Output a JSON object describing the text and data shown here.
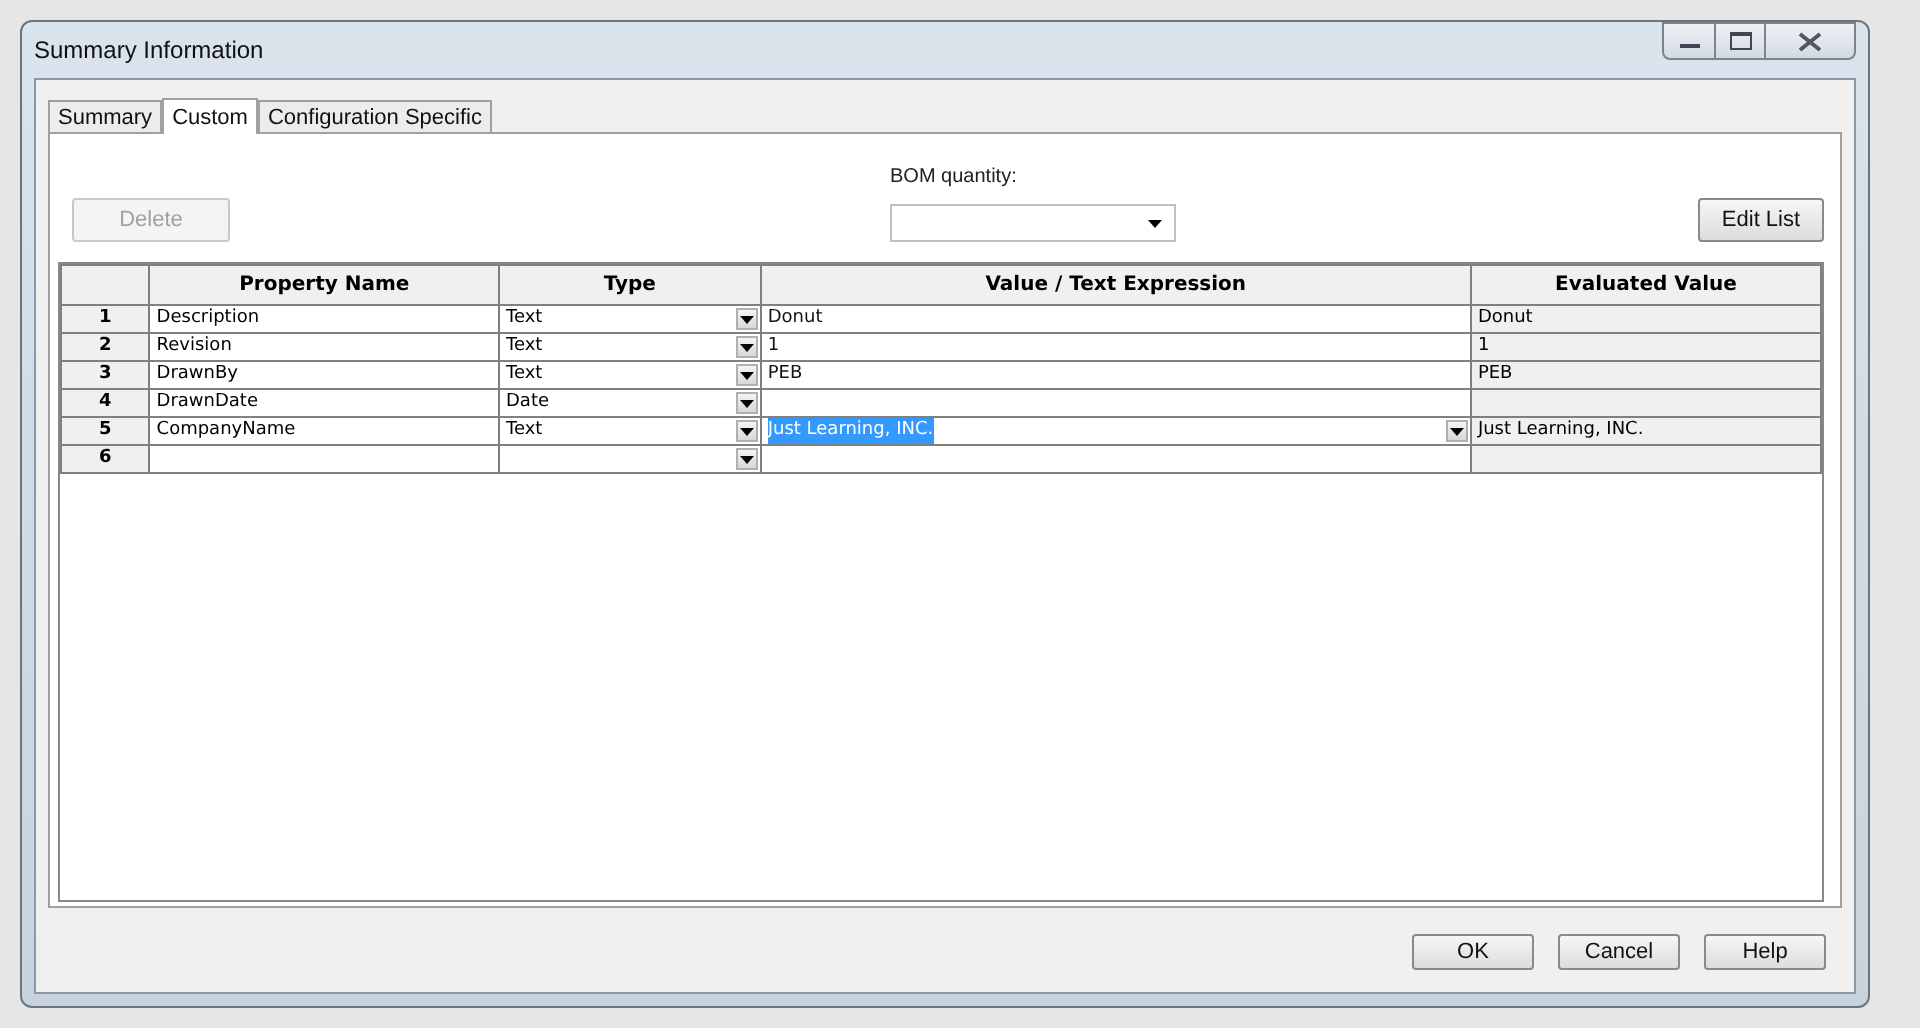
{
  "window": {
    "title": "Summary Information"
  },
  "tabs": [
    {
      "label": "Summary",
      "selected": false
    },
    {
      "label": "Custom",
      "selected": true
    },
    {
      "label": "Configuration Specific",
      "selected": false
    }
  ],
  "delete_button": {
    "label": "Delete",
    "disabled": true
  },
  "bom_quantity": {
    "label": "BOM quantity:"
  },
  "edit_list_button": {
    "label": "Edit List"
  },
  "table": {
    "columns": [
      "Property Name",
      "Type",
      "Value / Text Expression",
      "Evaluated Value"
    ],
    "rows": [
      {
        "number": "1",
        "name": "Description",
        "type": "Text",
        "value": "Donut",
        "evaluated": "Donut",
        "selected": false
      },
      {
        "number": "2",
        "name": "Revision",
        "type": "Text",
        "value": "1",
        "evaluated": "1",
        "selected": false
      },
      {
        "number": "3",
        "name": "DrawnBy",
        "type": "Text",
        "value": "PEB",
        "evaluated": "PEB",
        "selected": false
      },
      {
        "number": "4",
        "name": "DrawnDate",
        "type": "Date",
        "value": "",
        "evaluated": "",
        "selected": false
      },
      {
        "number": "5",
        "name": "CompanyName",
        "type": "Text",
        "value": "Just Learning, INC.",
        "evaluated": "Just Learning, INC.",
        "selected": true
      },
      {
        "number": "6",
        "name": "",
        "type": "",
        "value": "",
        "evaluated": "",
        "selected": false
      }
    ]
  },
  "buttons": [
    "OK",
    "Cancel",
    "Help"
  ]
}
